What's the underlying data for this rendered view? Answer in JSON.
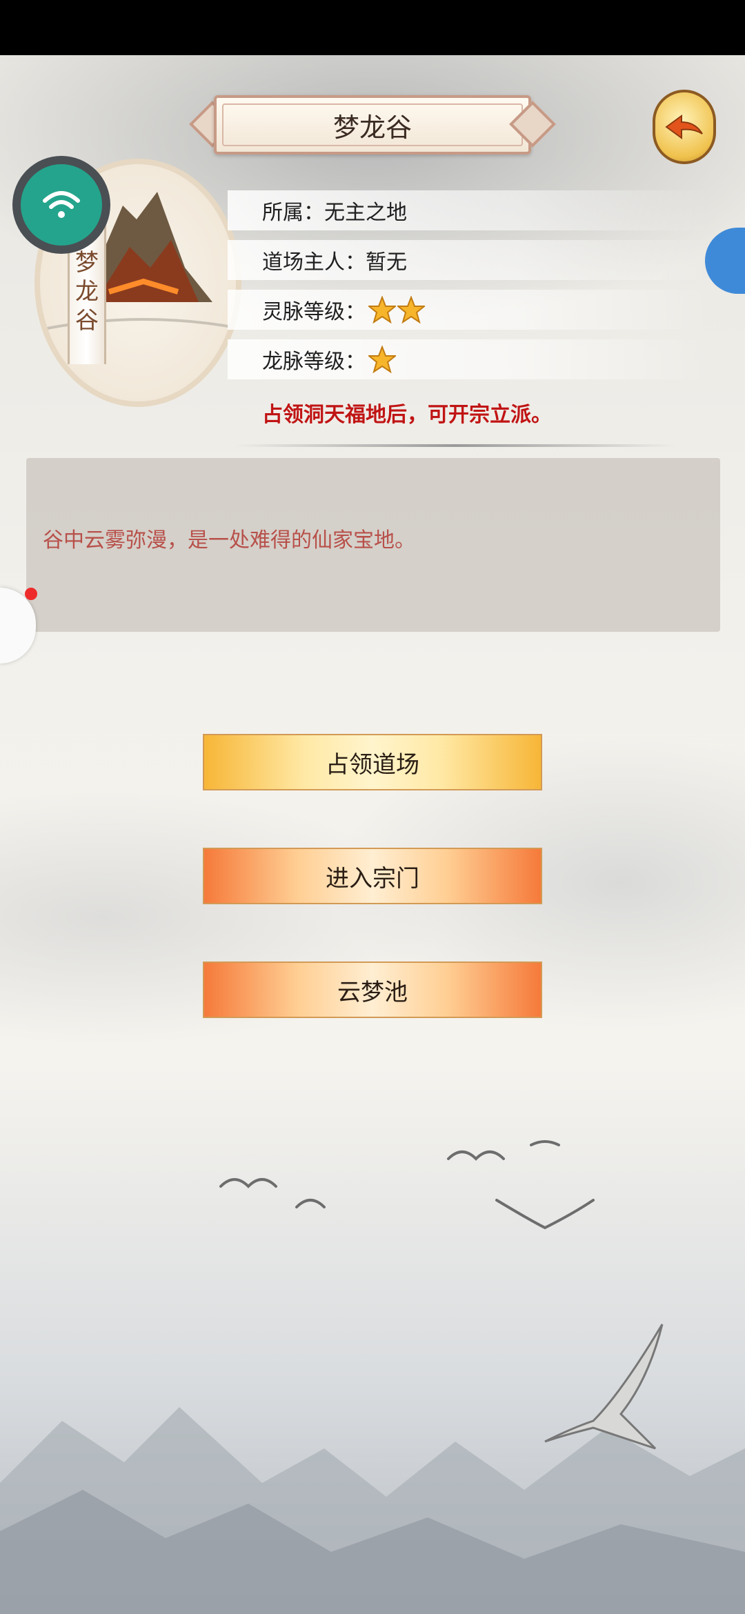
{
  "header": {
    "title": "梦龙谷"
  },
  "location": {
    "name_chars": [
      "梦",
      "龙",
      "谷"
    ],
    "fields": [
      {
        "label": "所属：无主之地"
      },
      {
        "label": "道场主人：暂无"
      },
      {
        "label": "灵脉等级：",
        "stars": 2
      },
      {
        "label": "龙脉等级：",
        "stars": 1
      }
    ],
    "note": "占领洞天福地后，可开宗立派。",
    "description": "谷中云雾弥漫，是一处难得的仙家宝地。"
  },
  "actions": [
    {
      "label": "占领道场",
      "style": "gold"
    },
    {
      "label": "进入宗门",
      "style": "orange"
    },
    {
      "label": "云梦池",
      "style": "orange"
    }
  ],
  "colors": {
    "note": "#c01414",
    "description": "#b8504a",
    "wifi_badge": "#24a48c",
    "notification_dot": "#ee2b2b"
  },
  "icons": [
    "back-arrow-icon",
    "wifi-icon",
    "star-icon"
  ]
}
